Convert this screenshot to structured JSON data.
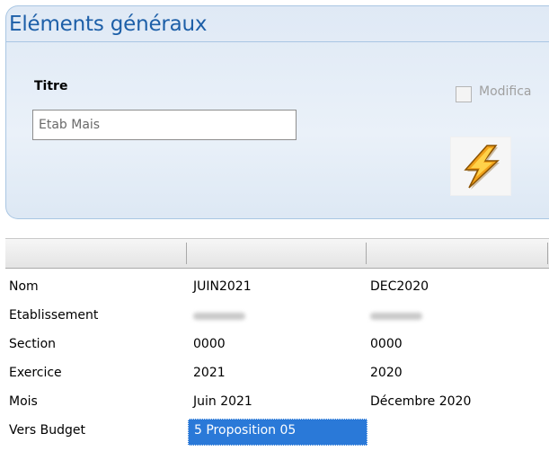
{
  "panel": {
    "title": "Eléments généraux",
    "titre_label": "Titre",
    "titre_value": "Etab Mais",
    "modif_label": "Modifica"
  },
  "grid": {
    "rows": [
      {
        "label": "Nom",
        "col1": "JUIN2021",
        "col2": "DEC2020"
      },
      {
        "label": "Etablissement",
        "col1": "",
        "col2": ""
      },
      {
        "label": "Section",
        "col1": "0000",
        "col2": "0000"
      },
      {
        "label": "Exercice",
        "col1": "2021",
        "col2": "2020"
      },
      {
        "label": "Mois",
        "col1": "Juin 2021",
        "col2": "Décembre 2020"
      },
      {
        "label": "Vers Budget",
        "col1": "5 Proposition 05",
        "col2": ""
      }
    ]
  },
  "colors": {
    "accent": "#1d5fa8",
    "selection": "#2a79d8"
  },
  "icons": {
    "action_button": "lightning-bolt-icon"
  }
}
